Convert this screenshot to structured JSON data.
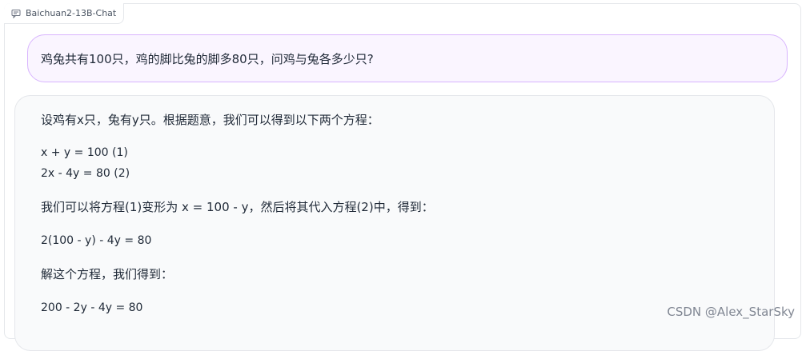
{
  "panel": {
    "label": "Baichuan2-13B-Chat",
    "icon": "chat-icon"
  },
  "user_message": {
    "text": "鸡兔共有100只，鸡的脚比兔的脚多80只，问鸡与兔各多少只?"
  },
  "bot_message": {
    "lines": [
      "设鸡有x只，兔有y只。根据题意，我们可以得到以下两个方程：",
      "x + y = 100 (1)",
      "2x - 4y = 80 (2)",
      "我们可以将方程(1)变形为 x = 100 - y，然后将其代入方程(2)中，得到：",
      "2(100 - y) - 4y = 80",
      "解这个方程，我们得到：",
      "200 - 2y - 4y = 80"
    ]
  },
  "watermark": "CSDN @Alex_StarSky",
  "colors": {
    "user_bubble_bg": "#faf5ff",
    "user_bubble_border": "#d8b4fe",
    "bot_bubble_bg": "#f9fafb",
    "text": "#1f2937"
  }
}
